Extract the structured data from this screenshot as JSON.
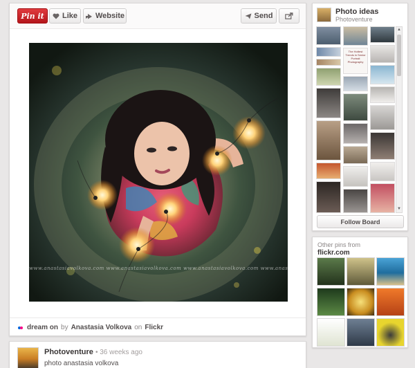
{
  "toolbar": {
    "pinit_label": "Pin it",
    "like_label": "Like",
    "website_label": "Website",
    "send_label": "Send"
  },
  "photo": {
    "watermark": "www.anastasiavolkova.com  www.anastasiavolkova.com  www.anastasiavolkova.com  www.anastasiavolkova.com"
  },
  "source": {
    "board": "dream on",
    "by_word": "by",
    "author": "Anastasia Volkova",
    "on_word": "on",
    "site": "Flickr"
  },
  "comment": {
    "user": "Photoventure",
    "time": "• 36 weeks ago",
    "text": "photo anastasia volkova"
  },
  "board": {
    "title": "Photo ideas",
    "owner": "Photoventure",
    "follow_label": "Follow Board",
    "tile_caption": "The Hottest Trends in Senior Portrait Photography"
  },
  "other": {
    "heading": "Other pins from",
    "domain": "flickr.com"
  },
  "colors": {
    "pinit_red": "#cb2027",
    "background": "#e9e7e7"
  }
}
